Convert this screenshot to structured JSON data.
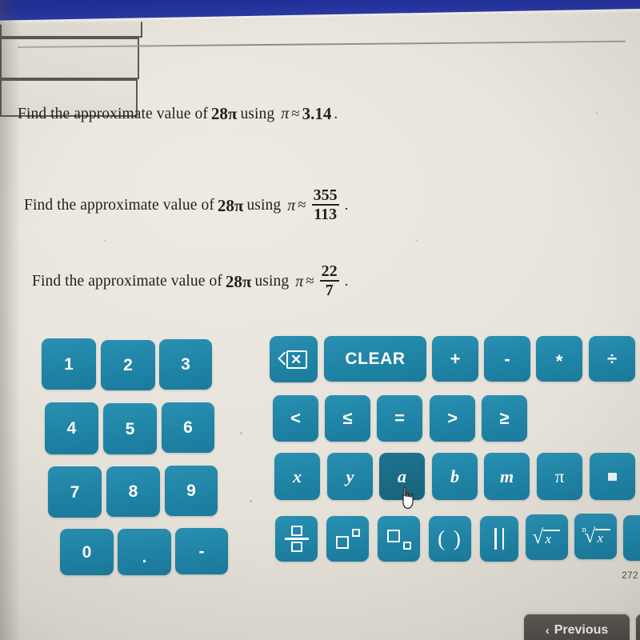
{
  "banner": {
    "color": "#1e2f96"
  },
  "theme": {
    "background": "#e9e5dd",
    "key_teal": "#1f84a6",
    "key_teal_hover": "#1a6b83",
    "nav_button": "#544f49",
    "text": "#232220"
  },
  "questions": [
    {
      "prefix": "Find the approximate value of",
      "expression": "28π",
      "using": "using",
      "pi": "π",
      "approx": "≈",
      "value_type": "decimal",
      "value": "3.14",
      "period": ".",
      "answer": ""
    },
    {
      "prefix": "Find the approximate value of",
      "expression": "28π",
      "using": "using",
      "pi": "π",
      "approx": "≈",
      "value_type": "fraction",
      "numerator": "355",
      "denominator": "113",
      "period": ".",
      "answer": ""
    },
    {
      "prefix": "Find the approximate value of",
      "expression": "28π",
      "using": "using",
      "pi": "π",
      "approx": "≈",
      "value_type": "fraction",
      "numerator": "22",
      "denominator": "7",
      "period": ".",
      "answer": ""
    }
  ],
  "keypad": {
    "numbers": [
      {
        "label": "1",
        "name": "key-1"
      },
      {
        "label": "2",
        "name": "key-2"
      },
      {
        "label": "3",
        "name": "key-3"
      },
      {
        "label": "4",
        "name": "key-4"
      },
      {
        "label": "5",
        "name": "key-5"
      },
      {
        "label": "6",
        "name": "key-6"
      },
      {
        "label": "7",
        "name": "key-7"
      },
      {
        "label": "8",
        "name": "key-8"
      },
      {
        "label": "9",
        "name": "key-9"
      },
      {
        "label": "0",
        "name": "key-0"
      },
      {
        "label": ".",
        "name": "key-decimal-point"
      },
      {
        "label": "-",
        "name": "key-negative-sign"
      }
    ],
    "row_operators": {
      "backspace": "backspace-icon",
      "clear": "CLEAR",
      "plus": "+",
      "minus": "-",
      "times": "*",
      "divide": "÷"
    },
    "row_comparisons": [
      {
        "label": "<",
        "name": "key-less-than"
      },
      {
        "label": "≤",
        "name": "key-less-than-or-equal"
      },
      {
        "label": "=",
        "name": "key-equals"
      },
      {
        "label": ">",
        "name": "key-greater-than"
      },
      {
        "label": "≥",
        "name": "key-greater-than-or-equal"
      }
    ],
    "row_variables": [
      {
        "label": "x",
        "name": "key-variable-x",
        "hovered": false
      },
      {
        "label": "y",
        "name": "key-variable-y",
        "hovered": false
      },
      {
        "label": "a",
        "name": "key-variable-a",
        "hovered": true
      },
      {
        "label": "b",
        "name": "key-variable-b",
        "hovered": false
      },
      {
        "label": "m",
        "name": "key-variable-m",
        "hovered": false
      },
      {
        "label": "π",
        "name": "key-pi",
        "hovered": false
      },
      {
        "label": "",
        "name": "key-placeholder-box",
        "hovered": false
      }
    ],
    "row_templates": [
      {
        "name": "key-fraction-template",
        "glyph": "fraction"
      },
      {
        "name": "key-superscript-template",
        "glyph": "superscript"
      },
      {
        "name": "key-subscript-template",
        "glyph": "subscript"
      },
      {
        "name": "key-parentheses",
        "glyph": "parentheses",
        "label": "( )"
      },
      {
        "name": "key-absolute-value",
        "glyph": "absolute-value"
      },
      {
        "name": "key-square-root",
        "glyph": "square-root"
      },
      {
        "name": "key-nth-root",
        "glyph": "nth-root"
      }
    ]
  },
  "footer": {
    "previous_label": "Previous",
    "previous_chevron": "‹",
    "page_number": "272"
  }
}
